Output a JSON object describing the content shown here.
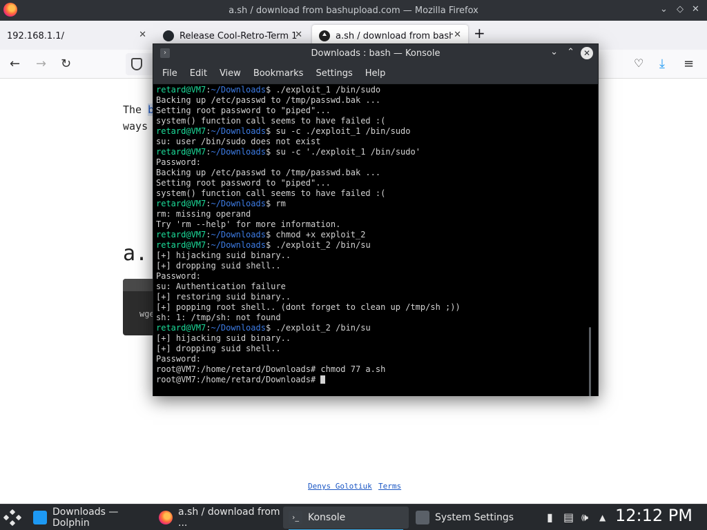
{
  "firefox": {
    "window_title": "a.sh / download from bashupload.com — Mozilla Firefox",
    "tabs": [
      {
        "label": "192.168.1.1/"
      },
      {
        "label": "Release Cool-Retro-Term 1"
      },
      {
        "label": "a.sh / download from bash"
      }
    ],
    "new_tab_label": "+",
    "page": {
      "intro_word": "The",
      "intro_link": "b",
      "line2": "ways",
      "heading": "a.",
      "code_snippet": "wge",
      "footer_links": [
        "Denys Golotiuk",
        "Terms"
      ]
    }
  },
  "konsole": {
    "window_title": "Downloads : bash — Konsole",
    "menu": [
      "File",
      "Edit",
      "View",
      "Bookmarks",
      "Settings",
      "Help"
    ],
    "prompt_user": "retard@VM7",
    "prompt_path": "~/Downloads",
    "lines": [
      {
        "type": "prompt",
        "cmd": "./exploit_1 /bin/sudo"
      },
      {
        "type": "out",
        "text": "Backing up /etc/passwd to /tmp/passwd.bak ..."
      },
      {
        "type": "out",
        "text": "Setting root password to \"piped\"..."
      },
      {
        "type": "out",
        "text": "system() function call seems to have failed :("
      },
      {
        "type": "prompt",
        "cmd": "su -c ./exploit_1 /bin/sudo"
      },
      {
        "type": "out",
        "text": "su: user /bin/sudo does not exist"
      },
      {
        "type": "prompt",
        "cmd": "su -c './exploit_1 /bin/sudo'"
      },
      {
        "type": "out",
        "text": "Password:"
      },
      {
        "type": "out",
        "text": "Backing up /etc/passwd to /tmp/passwd.bak ..."
      },
      {
        "type": "out",
        "text": "Setting root password to \"piped\"..."
      },
      {
        "type": "out",
        "text": "system() function call seems to have failed :("
      },
      {
        "type": "prompt",
        "cmd": "rm"
      },
      {
        "type": "out",
        "text": "rm: missing operand"
      },
      {
        "type": "out",
        "text": "Try 'rm --help' for more information."
      },
      {
        "type": "prompt",
        "cmd": "chmod +x exploit_2"
      },
      {
        "type": "prompt",
        "cmd": "./exploit_2 /bin/su"
      },
      {
        "type": "out",
        "text": "[+] hijacking suid binary.."
      },
      {
        "type": "out",
        "text": "[+] dropping suid shell.."
      },
      {
        "type": "out",
        "text": "Password:"
      },
      {
        "type": "out",
        "text": "su: Authentication failure"
      },
      {
        "type": "out",
        "text": "[+] restoring suid binary.."
      },
      {
        "type": "out",
        "text": "[+] popping root shell.. (dont forget to clean up /tmp/sh ;))"
      },
      {
        "type": "out",
        "text": "sh: 1: /tmp/sh: not found"
      },
      {
        "type": "prompt",
        "cmd": "./exploit_2 /bin/su"
      },
      {
        "type": "out",
        "text": "[+] hijacking suid binary.."
      },
      {
        "type": "out",
        "text": "[+] dropping suid shell.."
      },
      {
        "type": "out",
        "text": "Password:"
      },
      {
        "type": "out",
        "text": "root@VM7:/home/retard/Downloads# chmod 77 a.sh"
      },
      {
        "type": "cursor",
        "text": "root@VM7:/home/retard/Downloads# "
      }
    ]
  },
  "taskbar": {
    "tasks": [
      {
        "label": "Downloads — Dolphin",
        "icon": "dolphin-icon"
      },
      {
        "label": "a.sh / download from ...",
        "icon": "firefox-icon"
      },
      {
        "label": "Konsole",
        "icon": "konsole-icon"
      },
      {
        "label": "System Settings",
        "icon": "settings-icon"
      }
    ],
    "clock": "12:12 PM"
  },
  "colors": {
    "prompt_user": "#1cdc9a",
    "prompt_path": "#3d7ce5",
    "terminal_bg": "#000000",
    "terminal_fg": "#d3d3d3",
    "accent": "#3daee9"
  }
}
